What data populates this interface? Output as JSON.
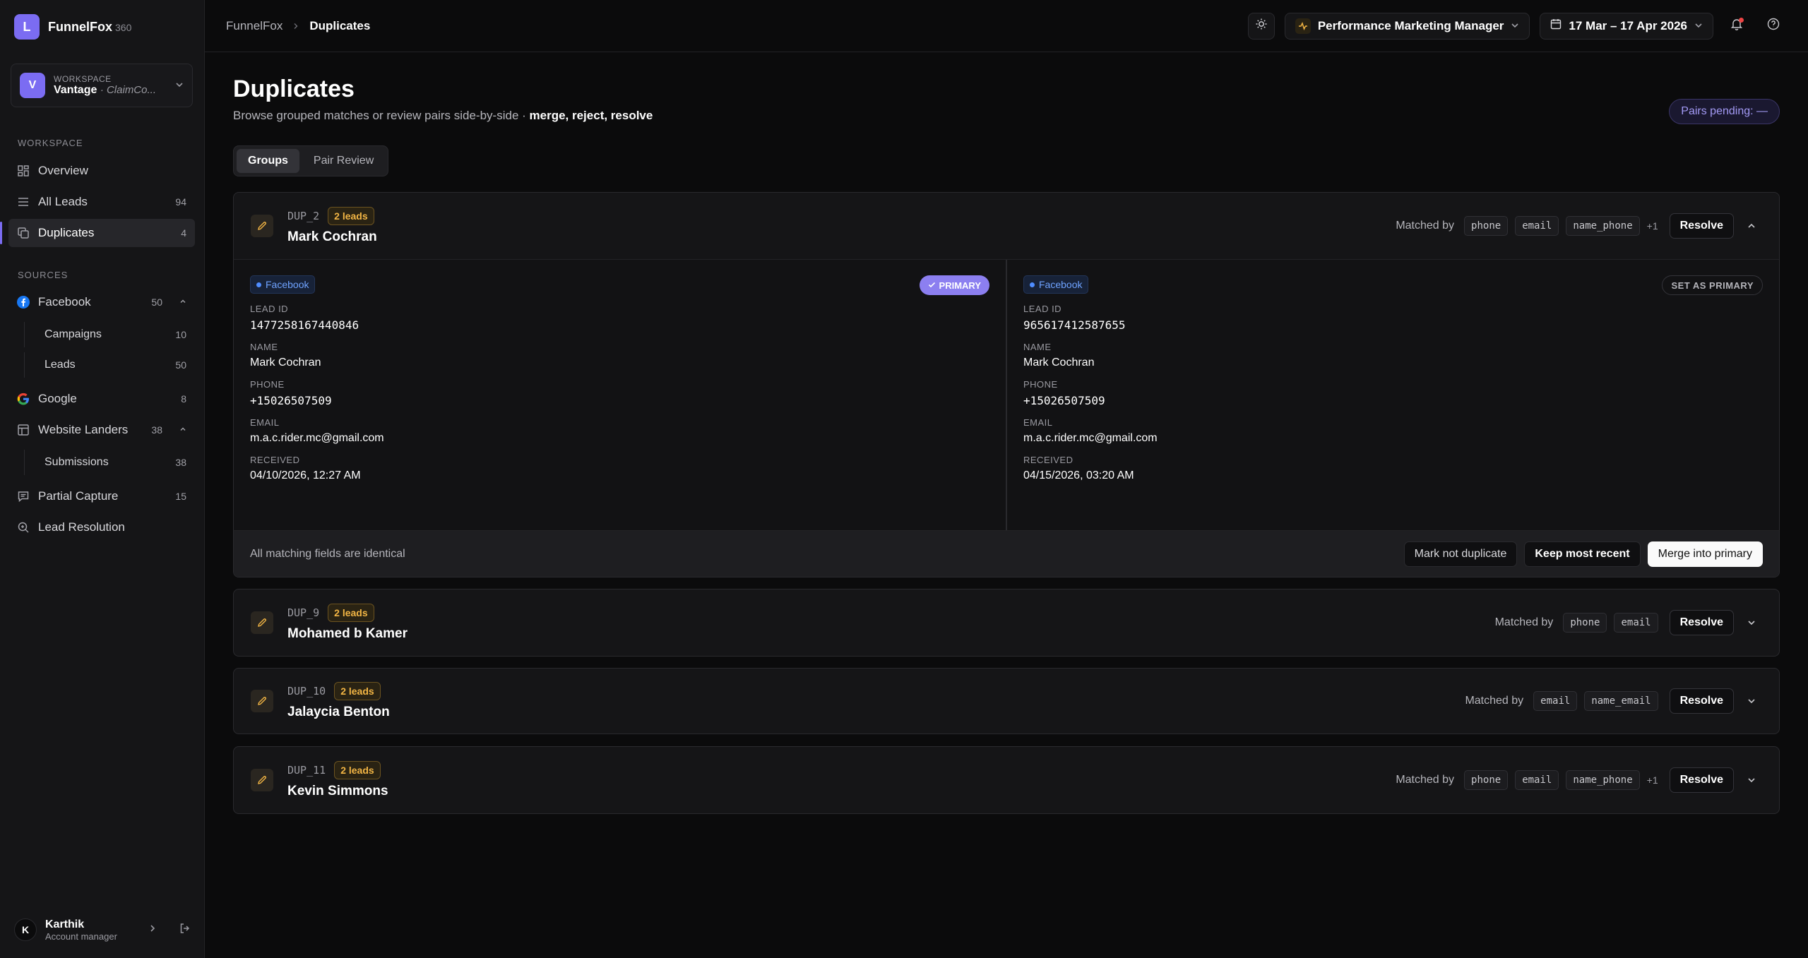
{
  "brand": {
    "logo_letter": "L",
    "name": "FunnelFox",
    "version": "360"
  },
  "workspace": {
    "avatar": "V",
    "label": "WORKSPACE",
    "name": "Vantage",
    "sub": "· ClaimCo..."
  },
  "sidebar": {
    "workspace_title": "WORKSPACE",
    "items": [
      {
        "label": "Overview",
        "count": ""
      },
      {
        "label": "All Leads",
        "count": "94"
      },
      {
        "label": "Duplicates",
        "count": "4"
      }
    ],
    "sources_title": "SOURCES",
    "sources": {
      "facebook": {
        "label": "Facebook",
        "count": "50"
      },
      "campaigns": {
        "label": "Campaigns",
        "count": "10"
      },
      "fb_leads": {
        "label": "Leads",
        "count": "50"
      },
      "google": {
        "label": "Google",
        "count": "8"
      },
      "landers": {
        "label": "Website Landers",
        "count": "38"
      },
      "submissions": {
        "label": "Submissions",
        "count": "38"
      },
      "partial": {
        "label": "Partial Capture",
        "count": "15"
      },
      "resolution": {
        "label": "Lead Resolution",
        "count": ""
      }
    }
  },
  "user": {
    "initial": "K",
    "name": "Karthik",
    "role": "Account manager"
  },
  "breadcrumb": {
    "root": "FunnelFox",
    "current": "Duplicates"
  },
  "topbar": {
    "role": "Performance Marketing Manager",
    "date_range": "17 Mar – 17 Apr 2026"
  },
  "page": {
    "title": "Duplicates",
    "subtitle": "Browse grouped matches or review pairs side-by-side · ",
    "subtitle_bold": "merge, reject, resolve",
    "pending": "Pairs pending: —",
    "tabs": [
      "Groups",
      "Pair Review"
    ]
  },
  "labels": {
    "matched_by": "Matched by",
    "resolve": "Resolve",
    "primary": "PRIMARY",
    "set_primary": "SET AS PRIMARY",
    "lead_id": "LEAD ID",
    "name": "NAME",
    "phone": "PHONE",
    "email": "EMAIL",
    "received": "RECEIVED"
  },
  "groups": [
    {
      "id": "DUP_2",
      "badge": "2 leads",
      "name": "Mark Cochran",
      "chips": [
        "phone",
        "email",
        "name_phone"
      ],
      "more": "+1",
      "leads": [
        {
          "source": "Facebook",
          "lead_id": "1477258167440846",
          "name": "Mark Cochran",
          "phone": "+15026507509",
          "email": "m.a.c.rider.mc@gmail.com",
          "received": "04/10/2026, 12:27 AM"
        },
        {
          "source": "Facebook",
          "lead_id": "965617412587655",
          "name": "Mark Cochran",
          "phone": "+15026507509",
          "email": "m.a.c.rider.mc@gmail.com",
          "received": "04/15/2026, 03:20 AM"
        }
      ],
      "footer": {
        "note": "All matching fields are identical",
        "not_dup": "Mark not duplicate",
        "keep_recent": "Keep most recent",
        "merge": "Merge into primary"
      }
    },
    {
      "id": "DUP_9",
      "badge": "2 leads",
      "name": "Mohamed b Kamer",
      "chips": [
        "phone",
        "email"
      ]
    },
    {
      "id": "DUP_10",
      "badge": "2 leads",
      "name": "Jalaycia Benton",
      "chips": [
        "email",
        "name_email"
      ]
    },
    {
      "id": "DUP_11",
      "badge": "2 leads",
      "name": "Kevin Simmons",
      "chips": [
        "phone",
        "email",
        "name_phone"
      ],
      "more": "+1"
    }
  ],
  "colors": {
    "accent": "#7b6cf2",
    "badge_amber": "#f2b544",
    "facebook_blue": "#4f8dff",
    "notification": "#ef4444"
  }
}
